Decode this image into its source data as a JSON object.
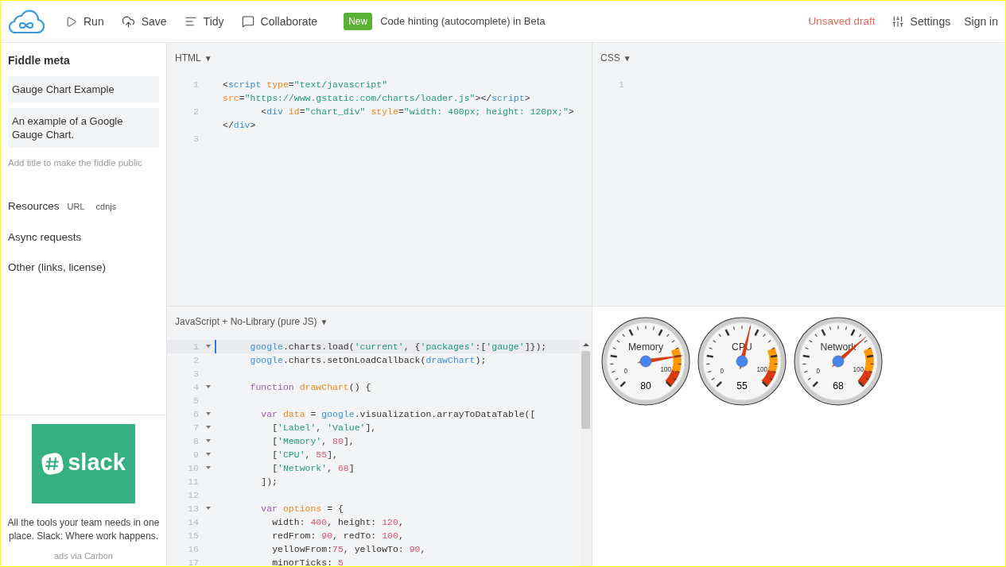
{
  "toolbar": {
    "actions": [
      {
        "kind": "run",
        "label": "Run"
      },
      {
        "kind": "save",
        "label": "Save"
      },
      {
        "kind": "tidy",
        "label": "Tidy"
      },
      {
        "kind": "collaborate",
        "label": "Collaborate"
      }
    ],
    "badge": "New",
    "announcement": "Code hinting (autocomplete) in Beta",
    "status": "Unsaved draft",
    "settings": "Settings",
    "sign_in": "Sign in"
  },
  "sidebar": {
    "title": "Fiddle meta",
    "fields": [
      "Gauge Chart Example",
      "An example of a Google Gauge Chart."
    ],
    "hint": "Add title to make the fiddle public",
    "resources": {
      "label": "Resources",
      "links": [
        "URL",
        "cdnjs"
      ]
    },
    "items": [
      "Async requests",
      "Other (links, license)"
    ],
    "ad": {
      "logo": "slack",
      "text": "All the tools your team needs in one place. Slack: Where work happens.",
      "via": "ads via Carbon"
    }
  },
  "html_panel": {
    "title": "HTML",
    "caret": "▼",
    "lines": [
      {
        "number": "1",
        "tokens": [
          {
            "kind": "plain",
            "text": "<"
          },
          {
            "kind": "tag",
            "text": "script"
          },
          {
            "kind": "attr",
            "text": " type"
          },
          {
            "kind": "plain",
            "text": "="
          },
          {
            "kind": "string",
            "text": "\"text/javascript\""
          },
          {
            "kind": "attr",
            "text": " src"
          },
          {
            "kind": "plain",
            "text": "="
          },
          {
            "kind": "string",
            "text": "\"https://www.gstatic.com/charts/loader.js\""
          },
          {
            "kind": "plain",
            "text": "></"
          },
          {
            "kind": "tag",
            "text": "script"
          },
          {
            "kind": "plain",
            "text": ">"
          }
        ]
      },
      {
        "number": "2",
        "tokens": [
          {
            "kind": "plain",
            "text": "       <"
          },
          {
            "kind": "tag",
            "text": "div"
          },
          {
            "kind": "attr",
            "text": " id"
          },
          {
            "kind": "plain",
            "text": "="
          },
          {
            "kind": "string",
            "text": "\"chart_div\""
          },
          {
            "kind": "attr",
            "text": " style"
          },
          {
            "kind": "plain",
            "text": "="
          },
          {
            "kind": "string",
            "text": "\"width: 400px; height: 120px;\""
          },
          {
            "kind": "plain",
            "text": "></"
          },
          {
            "kind": "tag",
            "text": "div"
          },
          {
            "kind": "plain",
            "text": ">"
          }
        ]
      },
      {
        "number": "3"
      }
    ]
  },
  "css_panel": {
    "title": "CSS",
    "caret": "▼",
    "lines": [
      {
        "number": "1"
      }
    ]
  },
  "js_panel": {
    "title": "JavaScript + No-Library (pure JS)",
    "caret": "▼",
    "lines": [
      {
        "number": "1",
        "fold": true,
        "active": true,
        "tokens": [
          {
            "kind": "builtin",
            "text": "     google"
          },
          {
            "kind": "plain",
            "text": ".charts.load("
          },
          {
            "kind": "string",
            "text": "'current'"
          },
          {
            "kind": "plain",
            "text": ", {"
          },
          {
            "kind": "string",
            "text": "'packages'"
          },
          {
            "kind": "plain",
            "text": ":["
          },
          {
            "kind": "string",
            "text": "'gauge'"
          },
          {
            "kind": "plain",
            "text": "]});"
          }
        ]
      },
      {
        "number": "2",
        "fold": false,
        "active": false,
        "tokens": [
          {
            "kind": "builtin",
            "text": "     google"
          },
          {
            "kind": "plain",
            "text": ".charts.setOnLoadCallback("
          },
          {
            "kind": "builtin",
            "text": "drawChart"
          },
          {
            "kind": "plain",
            "text": ");"
          }
        ]
      },
      {
        "number": "3",
        "fold": false,
        "active": false
      },
      {
        "number": "4",
        "fold": true,
        "active": false,
        "tokens": [
          {
            "kind": "keyword",
            "text": "     function"
          },
          {
            "kind": "def",
            "text": " drawChart"
          },
          {
            "kind": "plain",
            "text": "() {"
          }
        ]
      },
      {
        "number": "5",
        "fold": false,
        "active": false
      },
      {
        "number": "6",
        "fold": true,
        "active": false,
        "tokens": [
          {
            "kind": "keyword",
            "text": "       var"
          },
          {
            "kind": "def",
            "text": " data"
          },
          {
            "kind": "plain",
            "text": " = "
          },
          {
            "kind": "builtin",
            "text": "google"
          },
          {
            "kind": "plain",
            "text": ".visualization.arrayToDataTable(["
          }
        ]
      },
      {
        "number": "7",
        "fold": true,
        "active": false,
        "tokens": [
          {
            "kind": "plain",
            "text": "         ["
          },
          {
            "kind": "string",
            "text": "'Label'"
          },
          {
            "kind": "plain",
            "text": ", "
          },
          {
            "kind": "string",
            "text": "'Value'"
          },
          {
            "kind": "plain",
            "text": "],"
          }
        ]
      },
      {
        "number": "8",
        "fold": true,
        "active": false,
        "tokens": [
          {
            "kind": "plain",
            "text": "         ["
          },
          {
            "kind": "string",
            "text": "'Memory'"
          },
          {
            "kind": "plain",
            "text": ", "
          },
          {
            "kind": "number",
            "text": "80"
          },
          {
            "kind": "plain",
            "text": "],"
          }
        ]
      },
      {
        "number": "9",
        "fold": true,
        "active": false,
        "tokens": [
          {
            "kind": "plain",
            "text": "         ["
          },
          {
            "kind": "string",
            "text": "'CPU'"
          },
          {
            "kind": "plain",
            "text": ", "
          },
          {
            "kind": "number",
            "text": "55"
          },
          {
            "kind": "plain",
            "text": "],"
          }
        ]
      },
      {
        "number": "10",
        "fold": true,
        "active": false,
        "tokens": [
          {
            "kind": "plain",
            "text": "         ["
          },
          {
            "kind": "string",
            "text": "'Network'"
          },
          {
            "kind": "plain",
            "text": ", "
          },
          {
            "kind": "number",
            "text": "68"
          },
          {
            "kind": "plain",
            "text": "]"
          }
        ]
      },
      {
        "number": "11",
        "fold": false,
        "active": false,
        "tokens": [
          {
            "kind": "plain",
            "text": "       ]);"
          }
        ]
      },
      {
        "number": "12",
        "fold": false,
        "active": false
      },
      {
        "number": "13",
        "fold": true,
        "active": false,
        "tokens": [
          {
            "kind": "keyword",
            "text": "       var"
          },
          {
            "kind": "def",
            "text": " options"
          },
          {
            "kind": "plain",
            "text": " = {"
          }
        ]
      },
      {
        "number": "14",
        "fold": false,
        "active": false,
        "tokens": [
          {
            "kind": "plain",
            "text": "         width: "
          },
          {
            "kind": "number",
            "text": "400"
          },
          {
            "kind": "plain",
            "text": ", height: "
          },
          {
            "kind": "number",
            "text": "120"
          },
          {
            "kind": "plain",
            "text": ","
          }
        ]
      },
      {
        "number": "15",
        "fold": false,
        "active": false,
        "tokens": [
          {
            "kind": "plain",
            "text": "         redFrom: "
          },
          {
            "kind": "number",
            "text": "90"
          },
          {
            "kind": "plain",
            "text": ", redTo: "
          },
          {
            "kind": "number",
            "text": "100"
          },
          {
            "kind": "plain",
            "text": ","
          }
        ]
      },
      {
        "number": "16",
        "fold": false,
        "active": false,
        "tokens": [
          {
            "kind": "plain",
            "text": "         yellowFrom:"
          },
          {
            "kind": "number",
            "text": "75"
          },
          {
            "kind": "plain",
            "text": ", yellowTo: "
          },
          {
            "kind": "number",
            "text": "90"
          },
          {
            "kind": "plain",
            "text": ","
          }
        ]
      },
      {
        "number": "17",
        "fold": false,
        "active": false,
        "tokens": [
          {
            "kind": "plain",
            "text": "         minorTicks: "
          },
          {
            "kind": "number",
            "text": "5"
          }
        ]
      }
    ]
  },
  "result": {
    "gauges": [
      {
        "label": "Memory",
        "reading": "80",
        "min": "0",
        "max": "100"
      },
      {
        "label": "CPU",
        "reading": "55",
        "min": "0",
        "max": "100"
      },
      {
        "label": "Network",
        "reading": "68",
        "min": "0",
        "max": "100"
      }
    ]
  }
}
